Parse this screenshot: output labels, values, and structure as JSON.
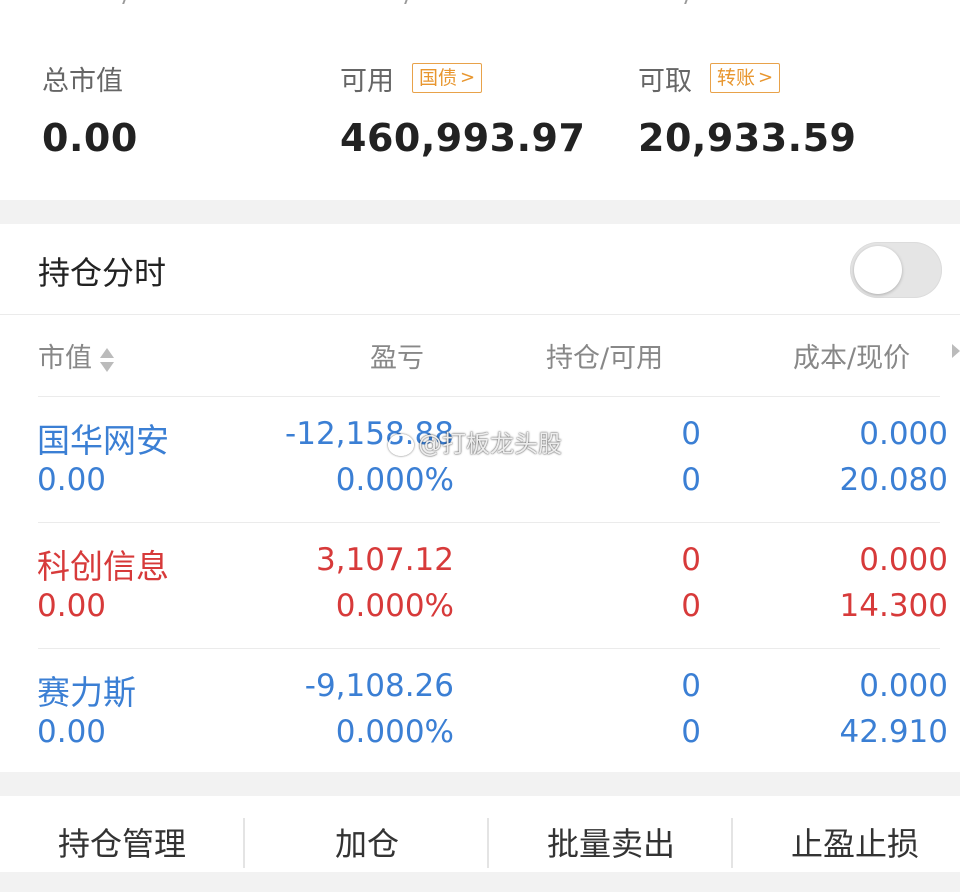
{
  "summary": {
    "total_market_value_label": "总市值",
    "total_market_value": "0.00",
    "available_label": "可用",
    "available_tag": "国债",
    "available": "460,993.97",
    "withdrawable_label": "可取",
    "withdrawable_tag": "转账",
    "withdrawable": "20,933.59"
  },
  "positions_section": {
    "title": "持仓分时",
    "toggle_on": false
  },
  "table": {
    "columns": [
      "市值",
      "盈亏",
      "持仓/可用",
      "成本/现价"
    ],
    "rows": [
      {
        "name": "国华网安",
        "market_value": "0.00",
        "pnl": "-12,158.88",
        "pnl_pct": "0.000%",
        "holding": "0",
        "available": "0",
        "cost": "0.000",
        "price": "20.080",
        "color": "#3b7fd4"
      },
      {
        "name": "科创信息",
        "market_value": "0.00",
        "pnl": "3,107.12",
        "pnl_pct": "0.000%",
        "holding": "0",
        "available": "0",
        "cost": "0.000",
        "price": "14.300",
        "color": "#d73a3a"
      },
      {
        "name": "赛力斯",
        "market_value": "0.00",
        "pnl": "-9,108.26",
        "pnl_pct": "0.000%",
        "holding": "0",
        "available": "0",
        "cost": "0.000",
        "price": "42.910",
        "color": "#3b7fd4"
      }
    ]
  },
  "watermark": "@打板龙头股",
  "footer": {
    "buttons": [
      "持仓管理",
      "加仓",
      "批量卖出",
      "止盈止损"
    ]
  },
  "colors": {
    "loss": "#3b7fd4",
    "gain": "#d73a3a",
    "tag": "#e8962e"
  }
}
